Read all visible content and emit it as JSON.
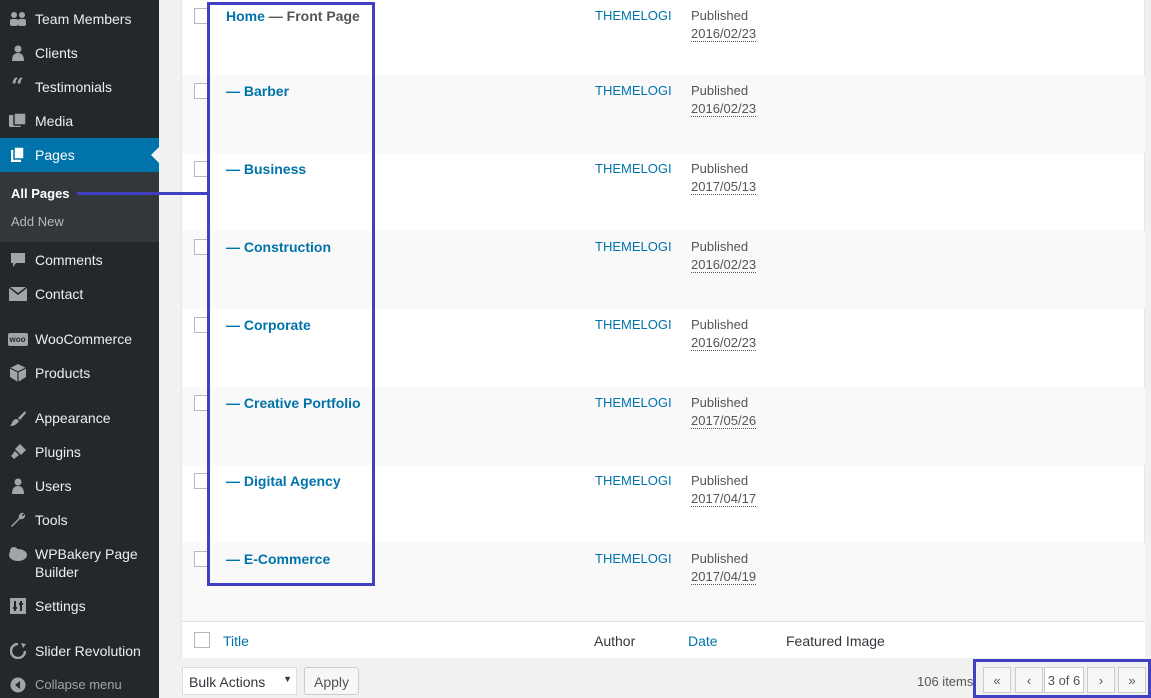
{
  "sidebar": {
    "items": [
      {
        "label": "Team Members",
        "icon": "team-icon"
      },
      {
        "label": "Clients",
        "icon": "clients-icon"
      },
      {
        "label": "Testimonials",
        "icon": "quote-icon"
      },
      {
        "label": "Media",
        "icon": "media-icon"
      },
      {
        "label": "Pages",
        "icon": "pages-icon",
        "active": true
      },
      {
        "label": "Comments",
        "icon": "comment-icon"
      },
      {
        "label": "Contact",
        "icon": "mail-icon"
      },
      {
        "label": "WooCommerce",
        "icon": "woo-icon"
      },
      {
        "label": "Products",
        "icon": "box-icon"
      },
      {
        "label": "Appearance",
        "icon": "brush-icon"
      },
      {
        "label": "Plugins",
        "icon": "plug-icon"
      },
      {
        "label": "Users",
        "icon": "user-icon"
      },
      {
        "label": "Tools",
        "icon": "wrench-icon"
      },
      {
        "label": "WPBakery Page Builder",
        "icon": "wpbakery-icon"
      },
      {
        "label": "Settings",
        "icon": "settings-icon"
      },
      {
        "label": "Slider Revolution",
        "icon": "refresh-icon"
      }
    ],
    "submenu": [
      {
        "label": "All Pages",
        "current": true
      },
      {
        "label": "Add New"
      }
    ],
    "collapse_label": "Collapse menu",
    "woo_badge": "woo"
  },
  "rows": [
    {
      "title": "Home",
      "state": " — Front Page",
      "author": "THEMELOGI",
      "status": "Published",
      "date": "2016/02/23"
    },
    {
      "title": "— Barber",
      "state": "",
      "author": "THEMELOGI",
      "status": "Published",
      "date": "2016/02/23"
    },
    {
      "title": "— Business",
      "state": "",
      "author": "THEMELOGI",
      "status": "Published",
      "date": "2017/05/13"
    },
    {
      "title": "— Construction",
      "state": "",
      "author": "THEMELOGI",
      "status": "Published",
      "date": "2016/02/23"
    },
    {
      "title": "— Corporate",
      "state": "",
      "author": "THEMELOGI",
      "status": "Published",
      "date": "2016/02/23"
    },
    {
      "title": "— Creative Portfolio",
      "state": "",
      "author": "THEMELOGI",
      "status": "Published",
      "date": "2017/05/26"
    },
    {
      "title": "— Digital Agency",
      "state": "",
      "author": "THEMELOGI",
      "status": "Published",
      "date": "2017/04/17"
    },
    {
      "title": "— E-Commerce",
      "state": "",
      "author": "THEMELOGI",
      "status": "Published",
      "date": "2017/04/19"
    }
  ],
  "columns": {
    "title": "Title",
    "author": "Author",
    "date": "Date",
    "featured": "Featured Image"
  },
  "bulk": {
    "label": "Bulk Actions",
    "apply": "Apply"
  },
  "pagination": {
    "count": "106 items",
    "first": "«",
    "prev": "‹",
    "current": "3 of 6",
    "next": "›",
    "last": "»"
  },
  "colors": {
    "sidebar": "#23282d",
    "active": "#0073aa",
    "link": "#0073aa",
    "annotation": "#4040c0"
  }
}
